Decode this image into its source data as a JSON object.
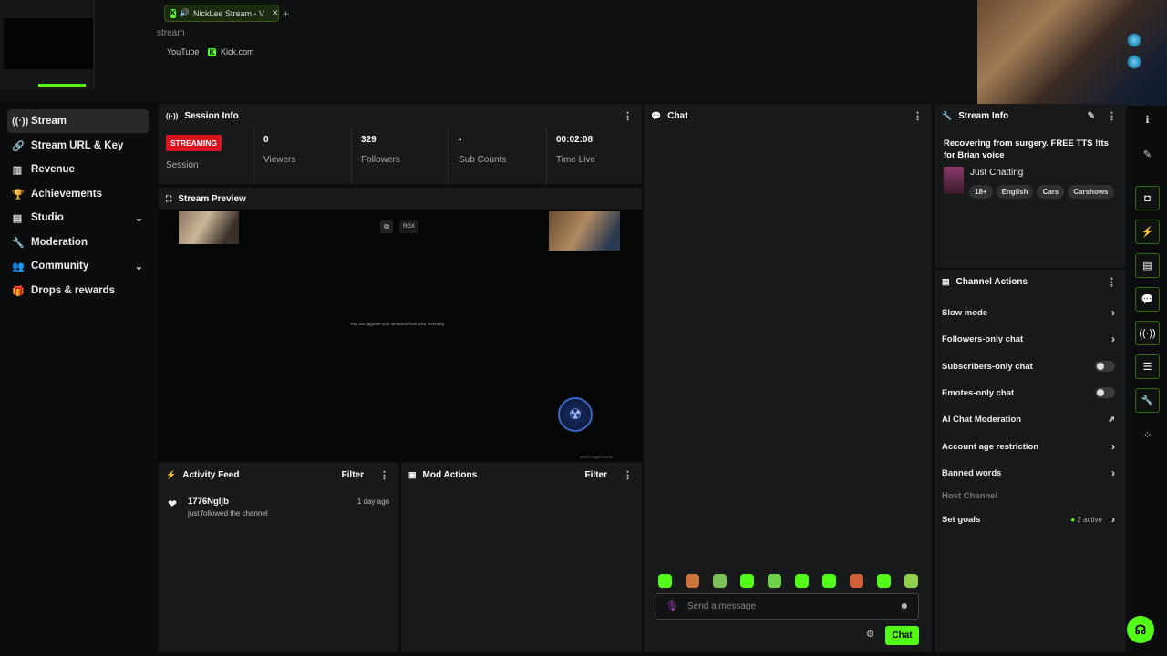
{
  "browser": {
    "tab_title": "NickLee Stream - V",
    "breadcrumb": "stream",
    "bookmarks": [
      "YouTube",
      "Kick.com"
    ]
  },
  "sidebar": {
    "items": [
      {
        "label": "Stream",
        "icon": "broadcast-icon",
        "active": true
      },
      {
        "label": "Stream URL & Key",
        "icon": "link-icon"
      },
      {
        "label": "Revenue",
        "icon": "chart-icon"
      },
      {
        "label": "Achievements",
        "icon": "trophy-icon"
      },
      {
        "label": "Studio",
        "icon": "layout-icon",
        "expandable": true
      },
      {
        "label": "Moderation",
        "icon": "wrench-icon"
      },
      {
        "label": "Community",
        "icon": "people-icon",
        "expandable": true
      },
      {
        "label": "Drops & rewards",
        "icon": "gift-icon"
      }
    ]
  },
  "session_info": {
    "title": "Session Info",
    "status_badge": "STREAMING",
    "session_label": "Session",
    "viewers_value": "0",
    "viewers_label": "Viewers",
    "followers_value": "329",
    "followers_label": "Followers",
    "subs_value": "-",
    "subs_label": "Sub Counts",
    "time_value": "00:02:08",
    "time_label": "Time Live"
  },
  "stream_preview": {
    "title": "Stream Preview",
    "overlay_tag": "RGX",
    "game_text": "You can upgrade your weapons from your Inventory.",
    "build_text": "p5501-rtrgp8-nw24s"
  },
  "activity_feed": {
    "title": "Activity Feed",
    "filter_label": "Filter",
    "items": [
      {
        "user": "1776Ngljb",
        "action": "just followed the channel",
        "time": "1 day ago"
      }
    ]
  },
  "mod_actions": {
    "title": "Mod Actions",
    "filter_label": "Filter"
  },
  "chat": {
    "title": "Chat",
    "placeholder": "Send a message",
    "send_label": "Chat"
  },
  "stream_info": {
    "title": "Stream Info",
    "stream_title": "Recovering from surgery. FREE TTS !tts for Brian voice",
    "category": "Just Chatting",
    "tags": [
      "18+",
      "English",
      "Cars",
      "Carshows"
    ]
  },
  "channel_actions": {
    "title": "Channel Actions",
    "items": [
      {
        "label": "Slow mode",
        "control": "chevron"
      },
      {
        "label": "Followers-only chat",
        "control": "chevron"
      },
      {
        "label": "Subscribers-only chat",
        "control": "toggle"
      },
      {
        "label": "Emotes-only chat",
        "control": "toggle"
      },
      {
        "label": "AI Chat Moderation",
        "control": "external"
      },
      {
        "label": "Account age restriction",
        "control": "chevron"
      },
      {
        "label": "Banned words",
        "control": "chevron"
      },
      {
        "label": "Host Channel",
        "control": "none",
        "disabled": true
      },
      {
        "label": "Set goals",
        "control": "chevron",
        "status": "2 active"
      }
    ]
  },
  "colors": {
    "accent": "#53fc18",
    "streaming": "#d9141f",
    "panel": "#18191b",
    "background": "#0b0c0d"
  }
}
